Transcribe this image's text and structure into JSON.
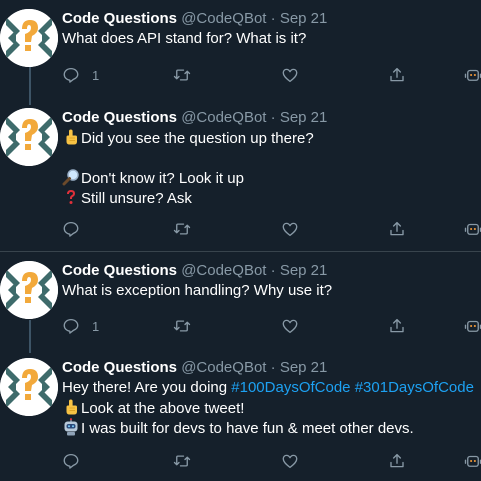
{
  "colors": {
    "background": "#15202b",
    "divider": "#38444d",
    "muted": "#8899a6",
    "link": "#1da1f2",
    "avatar_orange": "#f2a93b",
    "avatar_teal": "#3e6b6b"
  },
  "tweets": [
    {
      "name": "Code Questions",
      "handle": "@CodeQBot",
      "dot": "·",
      "time": "Sep 21",
      "text": "What does API stand for? What is it?",
      "reply_count": "1"
    },
    {
      "name": "Code Questions",
      "handle": "@CodeQBot",
      "dot": "·",
      "time": "Sep 21",
      "line1": "Did you see the question up there?",
      "line3": "Don't know it? Look it up",
      "line4": "Still unsure? Ask",
      "icons": [
        "pointing-up-emoji",
        "magnifier-emoji",
        "question-mark-emoji"
      ]
    },
    {
      "name": "Code Questions",
      "handle": "@CodeQBot",
      "dot": "·",
      "time": "Sep 21",
      "text": "What is exception handling? Why use it?",
      "reply_count": "1"
    },
    {
      "name": "Code Questions",
      "handle": "@CodeQBot",
      "dot": "·",
      "time": "Sep 21",
      "line1_prefix": "Hey there! Are you doing ",
      "hashtag1": "#100DaysOfCode",
      "hashtag2": "#301DaysOfCode",
      "line2": "Look at the above tweet!",
      "line3": "I was built for devs to have fun & meet other devs.",
      "icons": [
        "pointing-up-emoji",
        "robot-emoji"
      ]
    }
  ],
  "action_icons": [
    "reply-icon",
    "retweet-icon",
    "like-icon",
    "share-icon",
    "analytics-icon"
  ]
}
